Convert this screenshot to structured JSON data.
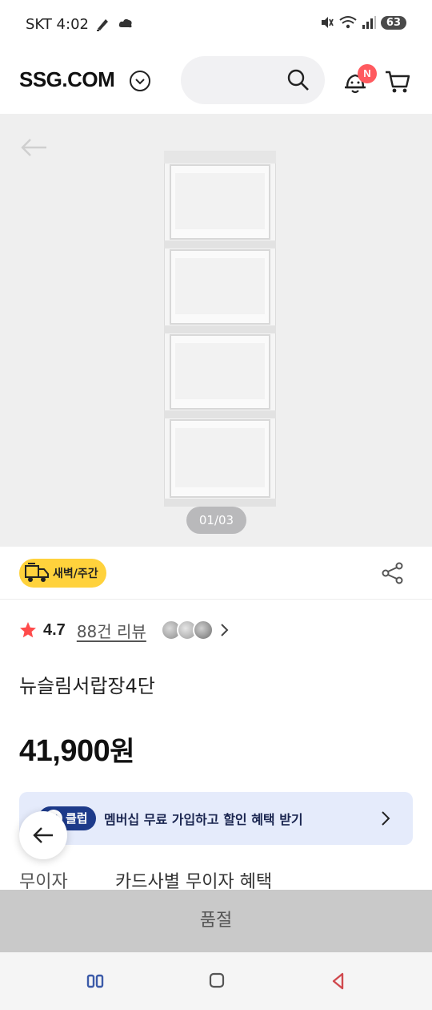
{
  "status_bar": {
    "time": "SKT 4:02",
    "battery": "63"
  },
  "header": {
    "logo": "SSG.COM",
    "notification_badge": "N"
  },
  "gallery": {
    "page_indicator": "01/03"
  },
  "delivery": {
    "badge_label": "새벽/주간"
  },
  "rating": {
    "score": "4.7",
    "review_link": "88건 리뷰"
  },
  "product": {
    "name": "뉴슬림서랍장4단",
    "price": "41,900",
    "price_unit": "원"
  },
  "membership": {
    "badge": "클럽",
    "badge_icon": "U",
    "text": "멤버십 무료 가입하고 할인 혜택 받기"
  },
  "installment": {
    "label": "무이자",
    "value": "카드사별 무이자 혜택"
  },
  "soldout": {
    "label": "품절"
  },
  "colors": {
    "accent_red": "#ff5a5f",
    "delivery_yellow": "#ffd23c",
    "membership_bg": "#e5ebfb",
    "membership_navy": "#1d3a8a"
  },
  "icons": [
    "search-icon",
    "bell-icon",
    "cart-icon",
    "back-arrow-icon",
    "share-icon",
    "star-icon",
    "chevron-right-icon",
    "chevron-down-icon",
    "truck-icon"
  ]
}
